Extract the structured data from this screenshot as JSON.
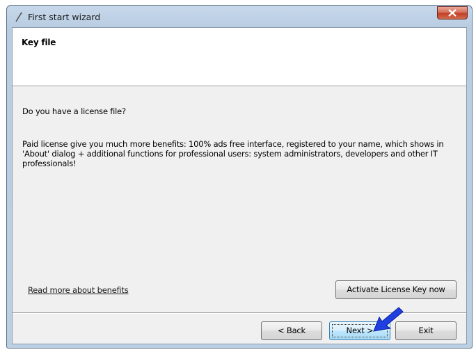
{
  "window": {
    "title": "First start wizard"
  },
  "header": {
    "title": "Key file"
  },
  "content": {
    "question": "Do you have a license file?",
    "description": "Paid license give you much more benefits: 100% ads free interface, registered to your name, which shows in 'About' dialog + additional functions for professional users: system administrators, developers and other IT professionals!",
    "read_more_link": "Read more about benefits",
    "activate_button": "Activate License Key now"
  },
  "footer": {
    "back_button": "< Back",
    "next_button": "Next >",
    "exit_button": "Exit"
  },
  "colors": {
    "annotation_arrow": "#1f3fe0"
  }
}
